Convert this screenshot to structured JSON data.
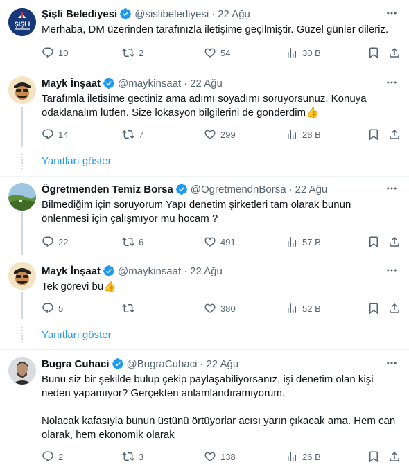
{
  "tweets": [
    {
      "name": "Şişli Belediyesi",
      "handle": "@sislibelediyesi",
      "time": "22 Ağu",
      "text": "Merhaba, DM üzerinden tarafınızla iletişime geçilmiştir. Güzel günler dileriz.",
      "replies": "10",
      "retweets": "2",
      "likes": "54",
      "views": "30 B",
      "avatar": "sisli-logo"
    },
    {
      "name": "Mayk İnşaat",
      "handle": "@maykinsaat",
      "time": "22 Ağu",
      "text": "Tarafımla iletisime gectiniz ama adımı soyadımı soruyorsunuz. Konuya odaklanalım lütfen. Size lokasyon bilgilerini de gonderdim",
      "emoji": "👍",
      "replies": "14",
      "retweets": "7",
      "likes": "299",
      "views": "28 B",
      "avatar": "cartoon-avatar"
    },
    {
      "name": "Ögretmenden Temiz Borsa",
      "handle": "@OgretmendnBorsa",
      "time": "22 Ağu",
      "text": "Bilmediğim için soruyorum Yapı denetim şirketleri tam olarak bunun önlenmesi için çalışmıyor mu hocam ?",
      "replies": "22",
      "retweets": "6",
      "likes": "491",
      "views": "57 B",
      "avatar": "landscape-avatar"
    },
    {
      "name": "Mayk İnşaat",
      "handle": "@maykinsaat",
      "time": "22 Ağu",
      "text": "Tek görevi bu",
      "emoji": "👍",
      "replies": "5",
      "retweets": "",
      "likes": "380",
      "views": "52 B",
      "avatar": "cartoon-avatar"
    },
    {
      "name": "Bugra Cuhaci",
      "handle": "@BugraCuhaci",
      "time": "22 Ağu",
      "text": "Bunu siz bir şekilde bulup çekip paylaşabiliyorsanız, işi denetim olan kişi neden yapamıyor? Gerçekten anlamlandıramıyorum.\n\nNolacak kafasıyla bunun üstünü örtüyorlar acısı yarın çıkacak ama. Hem can olarak, hem ekonomik olarak",
      "replies": "2",
      "retweets": "3",
      "likes": "138",
      "views": "26 B",
      "avatar": "photo-avatar"
    }
  ],
  "show_replies_label": "Yanıtları göster",
  "colors": {
    "accent": "#1d9bf0",
    "muted": "#536471",
    "text": "#0f1419",
    "border": "#eff3f4"
  }
}
